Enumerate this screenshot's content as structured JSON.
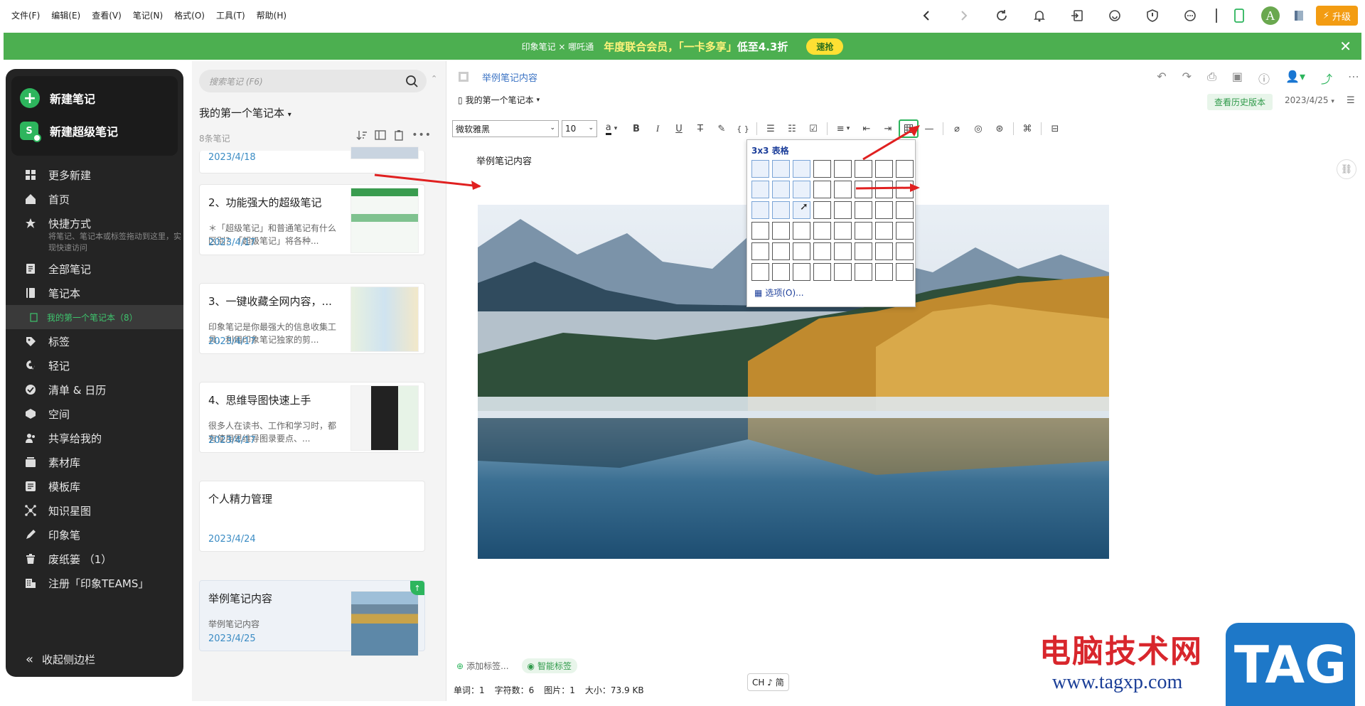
{
  "menu": {
    "file": "文件(F)",
    "edit": "编辑(E)",
    "view": "查看(V)",
    "note": "笔记(N)",
    "format": "格式(O)",
    "tools": "工具(T)",
    "help": "帮助(H)"
  },
  "top": {
    "upgrade": "升级",
    "avatar_letter": "A"
  },
  "banner": {
    "brand": "印象笔记 × 哪吒通",
    "text1": "年度联合会员，「一卡多享」",
    "text2": "低至4.3折",
    "button": "速抢",
    "close": "✕"
  },
  "sidebar": {
    "new_note": "新建笔记",
    "new_super_note": "新建超级笔记",
    "items": [
      {
        "label": "更多新建",
        "icon": "grid-icon"
      },
      {
        "label": "首页",
        "icon": "home-icon"
      },
      {
        "label": "快捷方式",
        "icon": "star-icon"
      },
      {
        "label": "全部笔记",
        "icon": "note-icon"
      },
      {
        "label": "笔记本",
        "icon": "notebook-icon"
      },
      {
        "label": "标签",
        "icon": "tag-icon"
      },
      {
        "label": "轻记",
        "icon": "quick-note-icon"
      },
      {
        "label": "清单 & 日历",
        "icon": "check-icon"
      },
      {
        "label": "空间",
        "icon": "space-icon"
      },
      {
        "label": "共享给我的",
        "icon": "share-people-icon"
      },
      {
        "label": "素材库",
        "icon": "library-icon"
      },
      {
        "label": "模板库",
        "icon": "template-icon"
      },
      {
        "label": "知识星图",
        "icon": "graph-icon"
      },
      {
        "label": "印象笔",
        "icon": "pen-icon"
      },
      {
        "label": "废纸篓 （1）",
        "icon": "trash-icon"
      },
      {
        "label": "注册「印象TEAMS」",
        "icon": "building-icon"
      }
    ],
    "shortcut_hint": "将笔记、笔记本或标签拖动到这里，实现快速访问",
    "active_notebook": "我的第一个笔记本（8）",
    "collapse": "收起侧边栏"
  },
  "list": {
    "search_placeholder": "搜索笔记 (F6)",
    "notebook": "我的第一个笔记本",
    "count": "8条笔记",
    "cards": [
      {
        "date": "2023/4/18"
      },
      {
        "title": "2、功能强大的超级笔记",
        "snippet": "＊「超级笔记」和普通笔记有什么区别？「超级笔记」将各种...",
        "date": "2023/4/17"
      },
      {
        "title": "3、一键收藏全网内容，...",
        "snippet": "印象笔记是你最强大的信息收集工具，利用印象笔记独家的剪...",
        "date": "2023/4/17"
      },
      {
        "title": "4、思维导图快速上手",
        "snippet": "很多人在读书、工作和学习时，都有使用思维导图录要点、...",
        "date": "2023/4/17"
      },
      {
        "title": "个人精力管理",
        "snippet": "",
        "date": "2023/4/24"
      },
      {
        "title": "举例笔记内容",
        "snippet": "举例笔记内容",
        "date": "2023/4/25"
      }
    ]
  },
  "editor": {
    "title": "举例笔记内容",
    "notebook": "我的第一个笔记本",
    "history": "查看历史版本",
    "date": "2023/4/25",
    "font": "微软雅黑",
    "size": "10",
    "body_text": "举例笔记内容",
    "table_popup_title": "3x3 表格",
    "table_options": "选项(O)...",
    "add_tag": "添加标签...",
    "smart_tag": "智能标签"
  },
  "status": {
    "words": "单词：1",
    "chars": "字符数：6",
    "images": "图片：1",
    "size": "大小：73.9 KB"
  },
  "ime": "CH ♪ 简",
  "watermark": {
    "text": "电脑技术网",
    "url": "www.tagxp.com",
    "logo": "TAG"
  },
  "colors": {
    "accent": "#2db55d",
    "banner": "#4caf50",
    "sidebar": "#242424",
    "link": "#3b73c4"
  }
}
